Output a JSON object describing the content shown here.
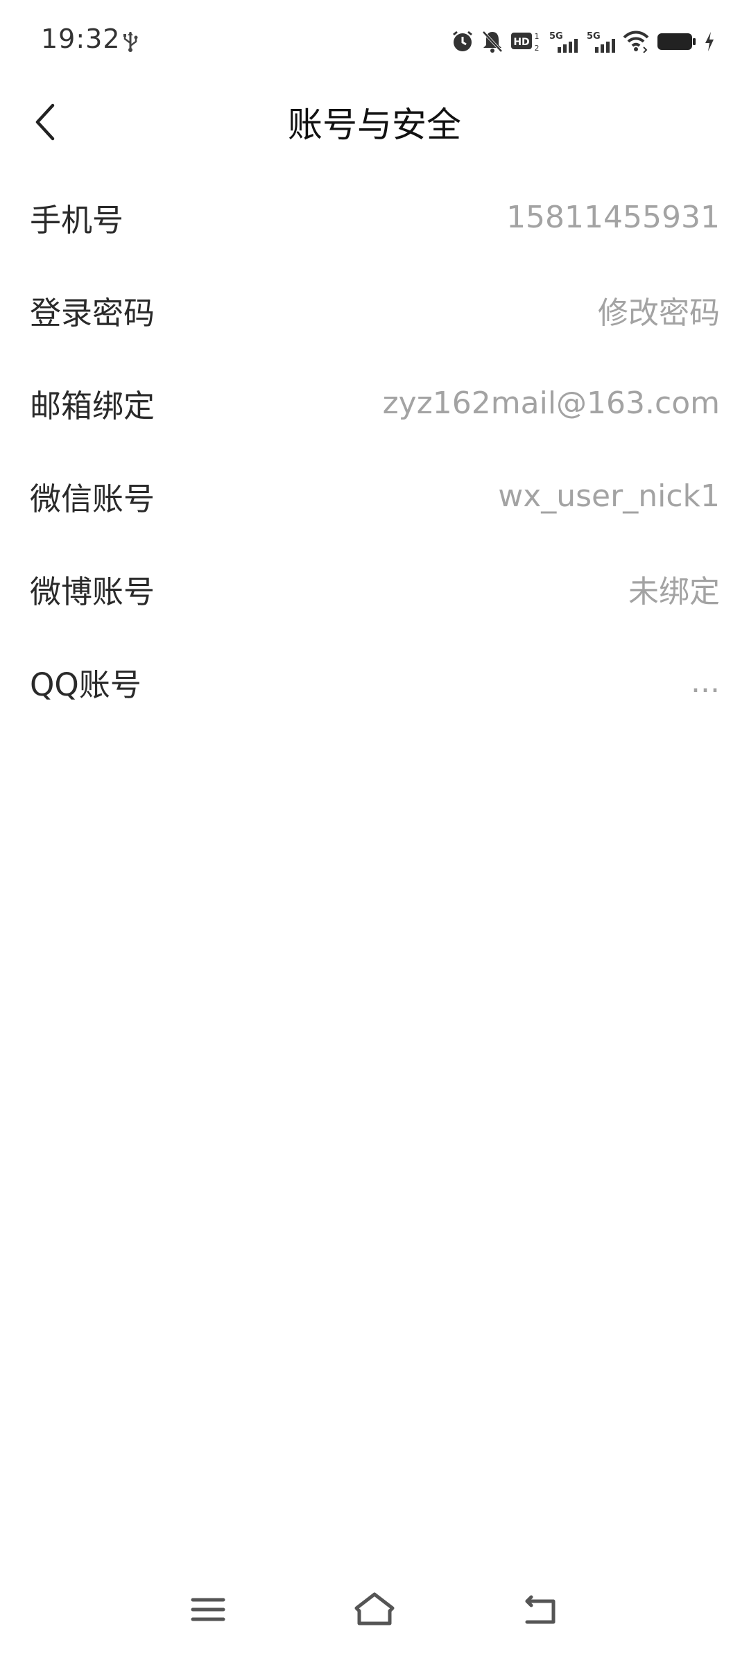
{
  "status_bar": {
    "time": "19:32",
    "icons": [
      "usb-icon",
      "alarm-icon",
      "mute-icon",
      "hd-icon",
      "signal-5g-icon",
      "signal-5g-icon",
      "wifi-icon",
      "battery-icon",
      "charging-icon"
    ],
    "hd_label": "HD",
    "network_label_1": "5G",
    "network_label_2": "5G"
  },
  "header": {
    "title": "账号与安全",
    "back_icon": "chevron-left-icon"
  },
  "settings": {
    "items": [
      {
        "label": "手机号",
        "value": "15811455931"
      },
      {
        "label": "登录密码",
        "value": "修改密码"
      },
      {
        "label": "邮箱绑定",
        "value": "zyz162mail@163.com"
      },
      {
        "label": "微信账号",
        "value": "wx_user_nick1"
      },
      {
        "label": "微博账号",
        "value": "未绑定"
      },
      {
        "label": "QQ账号",
        "value": "..."
      }
    ]
  },
  "nav_bar": {
    "icons": [
      "menu-icon",
      "home-icon",
      "back-nav-icon"
    ]
  },
  "colors": {
    "label": "#2a2a2a",
    "value": "#a3a3a3",
    "background": "#ffffff"
  }
}
